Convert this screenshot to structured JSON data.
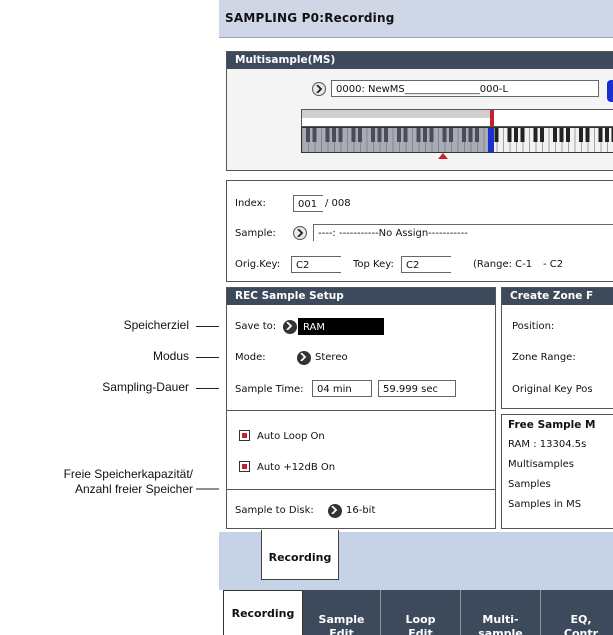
{
  "callouts": {
    "save_target": "Speicherziel",
    "mode": "Modus",
    "sampling_duration": "Sampling-Dauer",
    "free_memory_line1": "Freie Speicherkapazität/",
    "free_memory_line2": "Anzahl freier Speicher"
  },
  "header": {
    "title": "SAMPLING P0:Recording"
  },
  "multisample": {
    "title": "Multisample(MS)",
    "name_value": "0000: NewMS_______________000-L"
  },
  "index_panel": {
    "index_label": "Index:",
    "index_value": "001",
    "index_total": "/ 008",
    "sample_label": "Sample:",
    "sample_value": "----: -----------No Assign-----------",
    "origkey_label": "Orig.Key:",
    "origkey_value": "C2",
    "topkey_label": "Top Key:",
    "topkey_value": "C2",
    "range_label": "(Range: C-1",
    "range_value": "- C2"
  },
  "rec_setup": {
    "title": "REC Sample Setup",
    "save_label": "Save to:",
    "save_value": "RAM",
    "mode_label": "Mode:",
    "mode_value": "Stereo",
    "time_label": "Sample Time:",
    "time_min": "04 min",
    "time_sec": "59.999 sec",
    "auto_loop": "Auto Loop On",
    "auto_12db": "Auto +12dB On",
    "disk_label": "Sample to Disk:",
    "disk_value": "16-bit"
  },
  "create_zone": {
    "title": "Create Zone F",
    "position": "Position:",
    "zone_range": "Zone Range:",
    "orig_key_pos": "Original Key Pos"
  },
  "free_sample": {
    "title": "Free Sample M",
    "ram": "RAM :  13304.5s",
    "multisamples": "Multisamples",
    "samples": "Samples",
    "samples_in_ms": "Samples in MS"
  },
  "page_tab": "Recording",
  "tabs": [
    {
      "label": "Recording"
    },
    {
      "label": "Sample\nEdit"
    },
    {
      "label": "Loop\nEdit"
    },
    {
      "label": "Multi-\nsample"
    },
    {
      "label": "EQ,\nContr"
    }
  ],
  "colors": {
    "panel_header": "#3d4a5c",
    "title_bar": "#cfd7e6",
    "check_red": "#c8202a",
    "key_blue": "#1a2fd0"
  }
}
